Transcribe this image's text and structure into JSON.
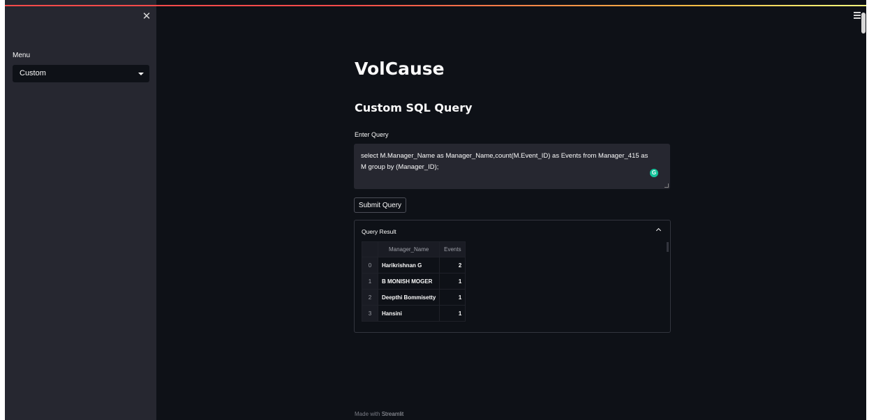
{
  "sidebar": {
    "menu_label": "Menu",
    "menu_selected": "Custom",
    "close_glyph": "✕"
  },
  "main": {
    "title": "VolCause",
    "subtitle": "Custom SQL Query",
    "query_label": "Enter Query",
    "query_value": "select M.Manager_Name as Manager_Name,count(M.Event_ID) as Events from Manager_415 as M group by (Manager_ID);",
    "submit_label": "Submit Query",
    "grammarly_glyph": "G",
    "expander_title": "Query Result",
    "table": {
      "columns": [
        "",
        "Manager_Name",
        "Events"
      ],
      "rows": [
        {
          "index": "0",
          "name": "Harikrishnan G",
          "events": "2"
        },
        {
          "index": "1",
          "name": "B MONISH MOGER",
          "events": "1"
        },
        {
          "index": "2",
          "name": "Deepthi Bommisetty",
          "events": "1"
        },
        {
          "index": "3",
          "name": "Hansini",
          "events": "1"
        }
      ]
    },
    "footer_prefix": "Made with",
    "footer_brand": "Streamlit"
  },
  "colors": {
    "background": "#0e1117",
    "sidebar": "#262730",
    "accent_red": "#ff4b4b",
    "grammarly_green": "#15c39a"
  },
  "icons": [
    "close-icon",
    "chevron-down-icon",
    "hamburger-menu-icon",
    "grammarly-icon",
    "chevron-up-icon",
    "resize-handle-icon"
  ]
}
